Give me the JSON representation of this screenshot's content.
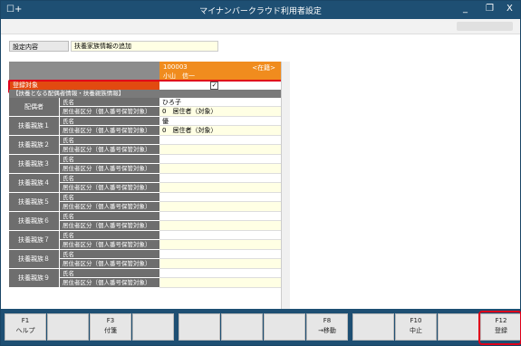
{
  "window": {
    "logo": "☐+",
    "title": "マイナンバークラウド利用者設定",
    "min": "_",
    "max": "❐",
    "close": "X"
  },
  "setting": {
    "label": "設定内容",
    "value": "扶養家族情報の追加"
  },
  "employee": {
    "code": "100003",
    "status": "<在籍>",
    "name": "小山　信一"
  },
  "register": {
    "label": "登録対象",
    "checked": "✓"
  },
  "section_title": "【扶養となる配偶者情報・扶養親族情報】",
  "row_labels": {
    "name": "氏名",
    "resident": "居住者区分（個人番号保管対象）"
  },
  "groups": [
    {
      "label": "配偶者",
      "name": "ひろ子",
      "resident": "0　居住者（対象）"
    },
    {
      "label": "扶養親族１",
      "name": "優",
      "resident": "0　居住者（対象）"
    },
    {
      "label": "扶養親族２",
      "name": "",
      "resident": ""
    },
    {
      "label": "扶養親族３",
      "name": "",
      "resident": ""
    },
    {
      "label": "扶養親族４",
      "name": "",
      "resident": ""
    },
    {
      "label": "扶養親族５",
      "name": "",
      "resident": ""
    },
    {
      "label": "扶養親族６",
      "name": "",
      "resident": ""
    },
    {
      "label": "扶養親族７",
      "name": "",
      "resident": ""
    },
    {
      "label": "扶養親族８",
      "name": "",
      "resident": ""
    },
    {
      "label": "扶養親族９",
      "name": "",
      "resident": ""
    }
  ],
  "fkeys": [
    {
      "key": "F1",
      "label": "ヘルプ"
    },
    {
      "key": "",
      "label": ""
    },
    {
      "key": "F3",
      "label": "付箋"
    },
    {
      "key": "",
      "label": ""
    },
    {
      "key": "",
      "label": ""
    },
    {
      "key": "",
      "label": ""
    },
    {
      "key": "",
      "label": ""
    },
    {
      "key": "F8",
      "label": "→移動"
    },
    {
      "key": "",
      "label": ""
    },
    {
      "key": "F10",
      "label": "中止"
    },
    {
      "key": "",
      "label": ""
    },
    {
      "key": "F12",
      "label": "登録"
    }
  ]
}
